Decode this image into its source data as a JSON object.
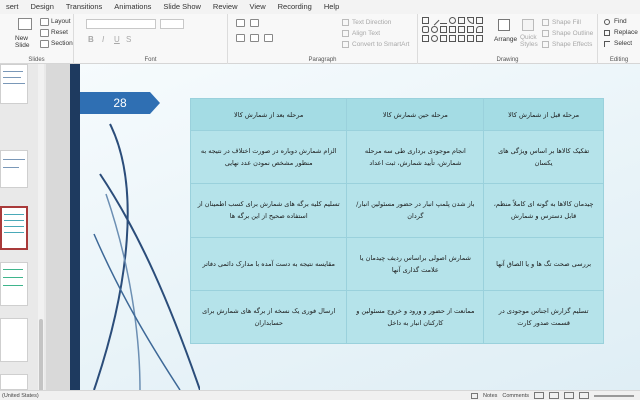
{
  "menu": [
    "sert",
    "Design",
    "Transitions",
    "Animations",
    "Slide Show",
    "Review",
    "View",
    "Recording",
    "Help"
  ],
  "ribbon": {
    "slides_group": {
      "new_slide": "New\nSlide",
      "layout": "Layout",
      "reset": "Reset",
      "section": "Section",
      "label": "Slides"
    },
    "font_group": {
      "bold": "B",
      "italic": "I",
      "underline": "U",
      "strike": "S",
      "label": "Font"
    },
    "paragraph_group": {
      "text_direction": "Text Direction",
      "align_text": "Align Text",
      "convert_smartart": "Convert to SmartArt",
      "label": "Paragraph"
    },
    "drawing_group": {
      "arrange": "Arrange",
      "quick_styles": "Quick\nStyles",
      "shape_fill": "Shape Fill",
      "shape_outline": "Shape Outline",
      "shape_effects": "Shape Effects",
      "label": "Drawing"
    },
    "editing_group": {
      "find": "Find",
      "replace": "Replace",
      "select": "Select",
      "label": "Editing"
    }
  },
  "slide": {
    "number": "28",
    "headers": [
      "مرحله قبل از شمارش کالا",
      "مرحله حین شمارش کالا",
      "مرحله بعد از شمارش کالا"
    ],
    "rows": [
      [
        "تفکیک کالاها بر اساس ویژگی های یکسان",
        "انجام موجودی برداری طی سه مرحله شمارش، تأیید شمارش، ثبت اعداد",
        "الزام شمارش دوباره در صورت اختلاف در نتیجه به منظور مشخص نمودن عدد نهایی"
      ],
      [
        "چیدمان کالاها به گونه ای کاملاً منظم، قابل دسترس و شمارش",
        "باز شدن پلمپ انبار در حضور مسئولین انبار/گردان",
        "تسلیم کلیه برگه های شمارش برای کسب اطمینان از استفاده صحیح از این برگه ها"
      ],
      [
        "بررسی صحت تگ ها و یا الصاق آنها",
        "شمارش اصولی براساس ردیف چیدمان یا علامت گذاری آنها",
        "مقایسه نتیجه به دست آمده با مدارک دائمی دفاتر"
      ],
      [
        "تسلیم گزارش اجناس موجودی در قسمت صدور کارت",
        "ممانعت از حضور و ورود و خروج مسئولین و کارکنان انبار به داخل",
        "ارسال فوری یک نسخه از برگه های شمارش برای حسابداران"
      ]
    ]
  },
  "statusbar": {
    "language": "(United States)",
    "notes": "Notes",
    "comments": "Comments"
  },
  "colors": {
    "accent_dark": "#1e3a5f",
    "number_tab": "#2f6fb3",
    "table_cell": "#b5e3ea",
    "active_thumb": "#a93a3a"
  }
}
